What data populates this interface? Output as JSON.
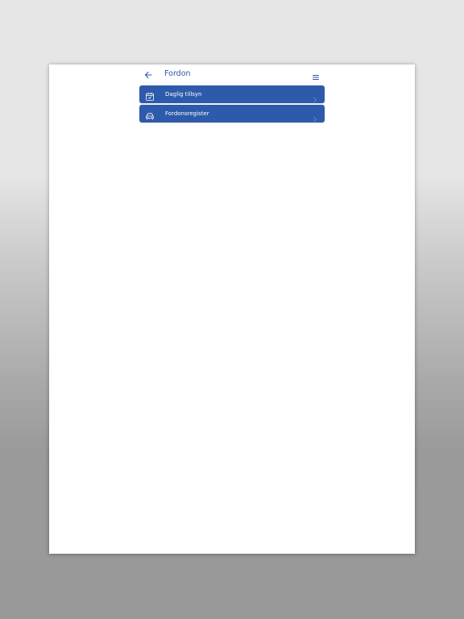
{
  "header": {
    "back_icon": "arrow-left-icon",
    "title": "Fordon",
    "menu_icon": "hamburger-menu-icon"
  },
  "menu": {
    "items": [
      {
        "label": "Daglig tillsyn",
        "icon": "calendar-check-icon"
      },
      {
        "label": "Fordonsregister",
        "icon": "car-icon"
      }
    ]
  },
  "colors": {
    "accent": "#2e5aab",
    "title": "#2b58a8",
    "background": "#ffffff"
  }
}
